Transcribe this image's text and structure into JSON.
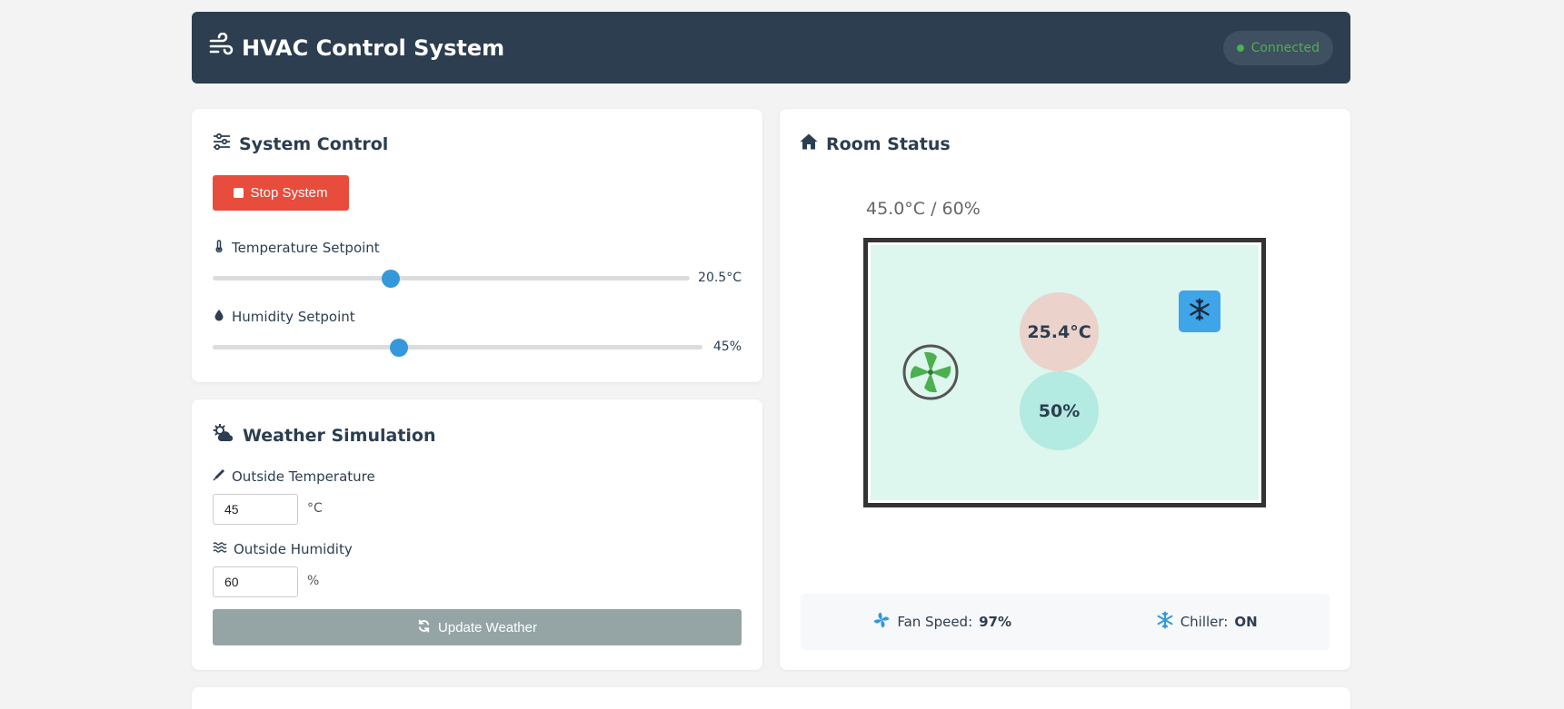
{
  "header": {
    "title": "HVAC Control System",
    "status": "Connected",
    "status_color": "#4caf50"
  },
  "control": {
    "title": "System Control",
    "stop_label": "Stop System",
    "temperature": {
      "label": "Temperature Setpoint",
      "value_text": "20.5°C",
      "fraction": 0.373
    },
    "humidity": {
      "label": "Humidity Setpoint",
      "value_text": "45%",
      "fraction": 0.38
    }
  },
  "weather": {
    "title": "Weather Simulation",
    "outside_temp": {
      "label": "Outside Temperature",
      "value": "45",
      "unit": "°C"
    },
    "outside_humidity": {
      "label": "Outside Humidity",
      "value": "60",
      "unit": "%"
    },
    "update_label": "Update Weather"
  },
  "room": {
    "title": "Room Status",
    "reading": "45.0°C / 60%",
    "temperature": "25.4°C",
    "humidity": "50%",
    "fan_speed_label": "Fan Speed:",
    "fan_speed": "97%",
    "chiller_label": "Chiller:",
    "chiller": "ON"
  },
  "icons": {
    "header": "wind-icon",
    "control": "sliders-icon",
    "temperature": "thermometer-icon",
    "humidity": "droplet-icon",
    "weather": "cloud-sun-icon",
    "outside_temp": "temperature-pen-icon",
    "outside_humidity": "water-waves-icon",
    "update": "sync-icon",
    "room": "home-icon",
    "fan": "fan-icon",
    "chiller": "snowflake-icon"
  },
  "colors": {
    "header_bg": "#2c3e50",
    "stop": "#e74c3c",
    "slider_thumb": "#3498db",
    "update_btn": "#95a5a6",
    "chiller": "#3fa4e8",
    "fan": "#4caf50"
  }
}
